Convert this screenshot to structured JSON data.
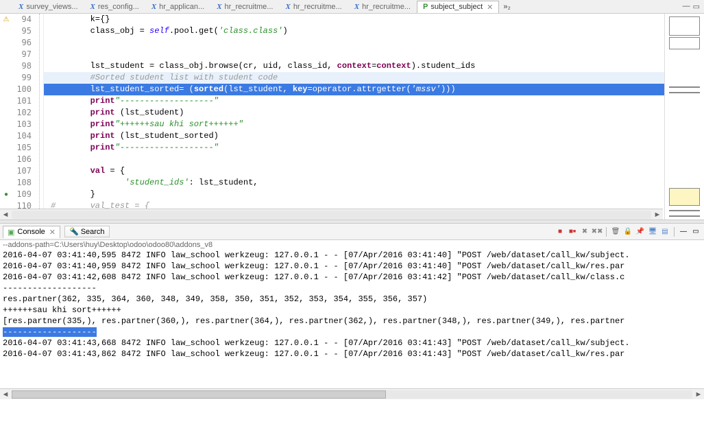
{
  "tabs": {
    "items": [
      {
        "icon": "X",
        "label": "survey_views..."
      },
      {
        "icon": "X",
        "label": "res_config..."
      },
      {
        "icon": "X",
        "label": "hr_applican..."
      },
      {
        "icon": "X",
        "label": "hr_recruitme..."
      },
      {
        "icon": "X",
        "label": "hr_recruitme..."
      },
      {
        "icon": "X",
        "label": "hr_recruitme..."
      },
      {
        "icon": "P",
        "label": "subject_subject",
        "active": true
      }
    ],
    "overflow": "»₂"
  },
  "code": {
    "lines": [
      {
        "n": 94,
        "marker": "warn",
        "indent": 1,
        "raw": "        k={}"
      },
      {
        "n": 95,
        "indent": 1,
        "raw": "        class_obj = self.pool.get('class.class')"
      },
      {
        "n": 96,
        "indent": 1,
        "raw": ""
      },
      {
        "n": 97,
        "indent": 1,
        "raw": ""
      },
      {
        "n": 98,
        "indent": 1,
        "raw": "        lst_student = class_obj.browse(cr, uid, class_id, context=context).student_ids"
      },
      {
        "n": 99,
        "indent": 1,
        "hl": "cursor",
        "raw": "        #Sorted student list with student code"
      },
      {
        "n": 100,
        "indent": 1,
        "hl": "sel",
        "raw": "        lst_student_sorted= (sorted(lst_student, key=operator.attrgetter('mssv')))"
      },
      {
        "n": 101,
        "indent": 1,
        "raw": "        print\"-------------------\""
      },
      {
        "n": 102,
        "indent": 1,
        "raw": "        print (lst_student)"
      },
      {
        "n": 103,
        "indent": 1,
        "raw": "        print\"++++++sau khi sort++++++\""
      },
      {
        "n": 104,
        "indent": 1,
        "raw": "        print (lst_student_sorted)"
      },
      {
        "n": 105,
        "indent": 1,
        "raw": "        print\"-------------------\""
      },
      {
        "n": 106,
        "indent": 1,
        "raw": ""
      },
      {
        "n": 107,
        "indent": 1,
        "raw": "        val = {"
      },
      {
        "n": 108,
        "indent": 1,
        "raw": "               'student_ids': lst_student,"
      },
      {
        "n": 109,
        "indent": 1,
        "marker": "green",
        "raw": "        }"
      },
      {
        "n": 110,
        "indent": 1,
        "cm": true,
        "raw": "#       val_test = {"
      }
    ]
  },
  "bottomTabs": {
    "console": "Console",
    "search": "Search"
  },
  "toolbar": {
    "stop": "■",
    "stopAll": "■",
    "clear": "✕",
    "clearAll": "✕✕",
    "lock": "🔒",
    "pin": "📌",
    "views": "☷"
  },
  "console": {
    "header": "--addons-path=C:\\Users\\huy\\Desktop\\odoo\\odoo80\\addons_v8",
    "lines": [
      "2016-04-07 03:41:40,595 8472 INFO law_school werkzeug: 127.0.0.1 - - [07/Apr/2016 03:41:40] \"POST /web/dataset/call_kw/subject.",
      "2016-04-07 03:41:40,959 8472 INFO law_school werkzeug: 127.0.0.1 - - [07/Apr/2016 03:41:40] \"POST /web/dataset/call_kw/res.par",
      "2016-04-07 03:41:42,608 8472 INFO law_school werkzeug: 127.0.0.1 - - [07/Apr/2016 03:41:42] \"POST /web/dataset/call_kw/class.c",
      "-------------------",
      "res.partner(362, 335, 364, 360, 348, 349, 358, 350, 351, 352, 353, 354, 355, 356, 357)",
      "++++++sau khi sort++++++",
      "[res.partner(335,), res.partner(360,), res.partner(364,), res.partner(362,), res.partner(348,), res.partner(349,), res.partner",
      "-------------------",
      "2016-04-07 03:41:43,668 8472 INFO law_school werkzeug: 127.0.0.1 - - [07/Apr/2016 03:41:43] \"POST /web/dataset/call_kw/subject.",
      "2016-04-07 03:41:43,862 8472 INFO law_school werkzeug: 127.0.0.1 - - [07/Apr/2016 03:41:43] \"POST /web/dataset/call_kw/res.par"
    ],
    "selLine": 7
  }
}
